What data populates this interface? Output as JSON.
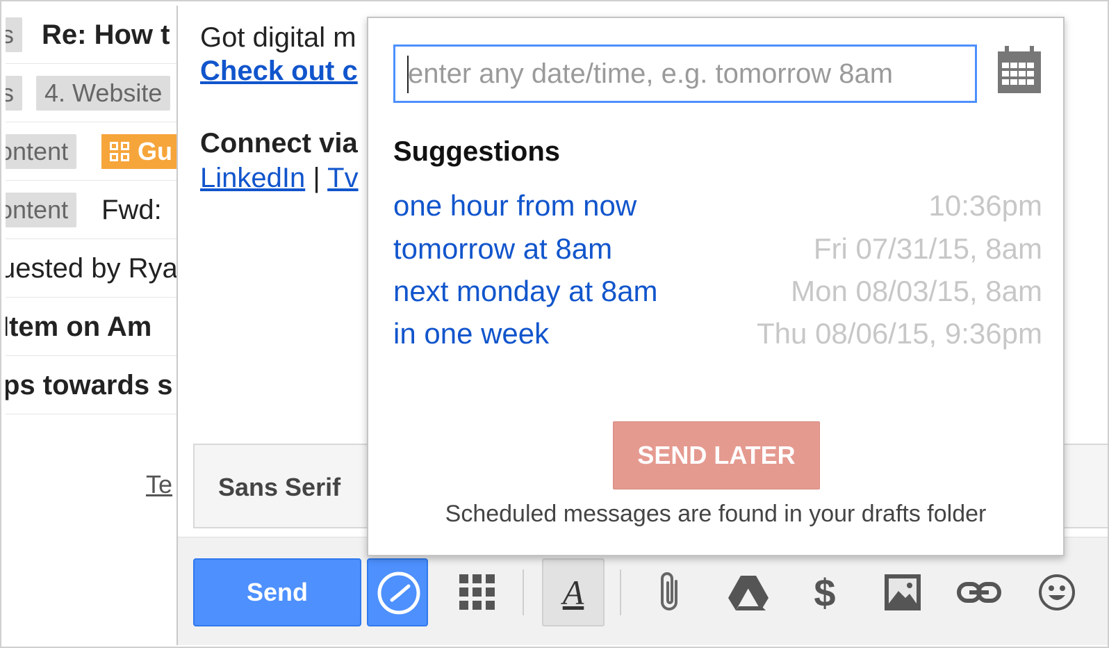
{
  "inbox": {
    "rows": [
      {
        "label": "s",
        "subject": "Re: How t",
        "bold": true
      },
      {
        "label": "s",
        "subject": "4. Website",
        "bold": false
      },
      {
        "label": "ontent",
        "subject": "Gu",
        "bold": true
      },
      {
        "label": "ontent",
        "subject": "Fwd:",
        "bold": false
      },
      {
        "subject": "uested by Rya",
        "bold": false
      },
      {
        "subject": " Item on Am",
        "bold": true
      },
      {
        "subject": "ps towards s",
        "bold": true
      }
    ],
    "teaser": "Te"
  },
  "compose": {
    "line1": "Got digital m",
    "link1": "Check out c",
    "connect": "Connect via",
    "linkedin": "LinkedIn",
    "sep": "|",
    "twitter": "Tv",
    "font_name": "Sans Serif",
    "send_label": "Send"
  },
  "popup": {
    "placeholder": "enter any date/time, e.g. tomorrow 8am",
    "suggestions_title": "Suggestions",
    "suggestions": [
      {
        "label": "one hour from now",
        "time": "10:36pm"
      },
      {
        "label": "tomorrow at 8am",
        "time": "Fri 07/31/15, 8am"
      },
      {
        "label": "next monday at 8am",
        "time": "Mon 08/03/15, 8am"
      },
      {
        "label": "in one week",
        "time": "Thu 08/06/15, 9:36pm"
      }
    ],
    "send_later_label": "SEND LATER",
    "note": "Scheduled messages are found in your drafts folder"
  },
  "toolbar": {
    "icons": [
      "clock-icon",
      "apps-grid-icon",
      "text-format-icon",
      "paperclip-icon",
      "drive-icon",
      "dollar-icon",
      "photo-icon",
      "link-icon",
      "emoji-icon"
    ],
    "dollar_glyph": "$",
    "format_glyph": "A"
  },
  "colors": {
    "primary_blue": "#4d90fe",
    "link_blue": "#1155cc",
    "send_later": "#e59a90",
    "orange_label": "#f6a53b"
  }
}
